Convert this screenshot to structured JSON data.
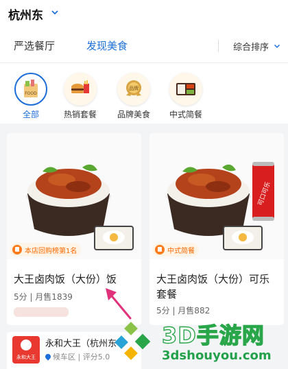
{
  "header": {
    "city": "杭州东"
  },
  "tabs": [
    {
      "label": "严选餐厅"
    },
    {
      "label": "发现美食"
    }
  ],
  "sort": {
    "label": "综合排序"
  },
  "categories": [
    {
      "label": "全部",
      "icon": "food-bag-icon",
      "badge": "FOOD"
    },
    {
      "label": "热销套餐",
      "icon": "burger-meal-icon"
    },
    {
      "label": "品牌美食",
      "icon": "brand-medal-icon",
      "badge": "品牌"
    },
    {
      "label": "中式简餐",
      "icon": "bento-box-icon"
    }
  ],
  "cards": [
    {
      "tag": "本店回购榜第1名",
      "name": "大王卤肉饭（大份）饭",
      "meta": "5分 | 月售1839"
    },
    {
      "tag": "中式简餐",
      "name": "大王卤肉饭（大份）可乐套餐",
      "meta": "5分 | 月售882",
      "can_text": "可口可乐"
    }
  ],
  "shop": {
    "logo_text": "永和大王",
    "name": "永和大王（杭州东",
    "meta": "候车区 | 评分5.0"
  },
  "watermark": {
    "big": "3D手游网",
    "url": "3dshouyou.com"
  },
  "colors": {
    "accent": "#1e6fd9",
    "tag_orange": "#ff6a00",
    "arrow": "#e0327a"
  }
}
